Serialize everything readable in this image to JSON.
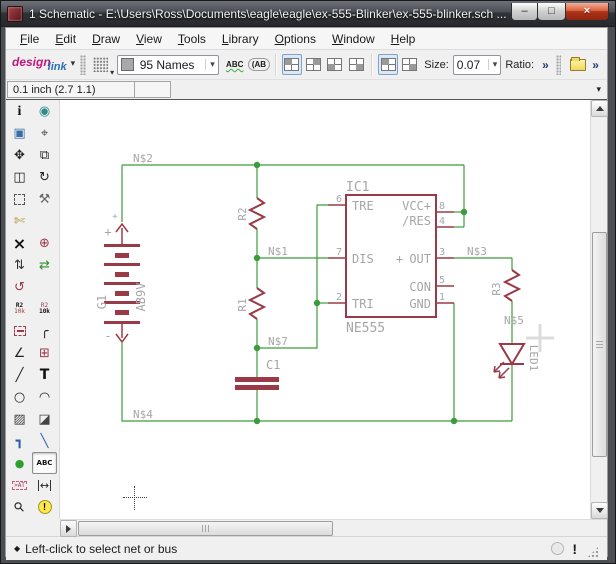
{
  "window": {
    "title": "1 Schematic - E:\\Users\\Ross\\Documents\\eagle\\eagle\\ex-555-Blinker\\ex-555-blinker.sch ...",
    "minimize": "–",
    "maximize": "□",
    "close": "×"
  },
  "menu": {
    "items": [
      {
        "accel": "F",
        "rest": "ile"
      },
      {
        "accel": "E",
        "rest": "dit"
      },
      {
        "accel": "D",
        "rest": "raw"
      },
      {
        "accel": "V",
        "rest": "iew"
      },
      {
        "accel": "T",
        "rest": "ools"
      },
      {
        "accel": "L",
        "rest": "ibrary"
      },
      {
        "accel": "O",
        "rest": "ptions"
      },
      {
        "accel": "W",
        "rest": "indow"
      },
      {
        "accel": "H",
        "rest": "elp"
      }
    ]
  },
  "toolbar": {
    "logo_design": "design",
    "logo_link": "link",
    "logo_drop": "▾",
    "layer_combo_value": "95 Names",
    "combo_arrow": "▾",
    "abc": "ABC",
    "ab": "(AB",
    "size_label": "Size:",
    "size_value": "0.07",
    "ratio_label": "Ratio:",
    "chevron": "»"
  },
  "coordbar": {
    "readout": "0.1 inch (2.7 1.1)",
    "overflow_arrow": "▾"
  },
  "palette": {
    "glyphs": {
      "info": "i",
      "show": "◉",
      "display": "▣",
      "mark": "⌖",
      "move": "✥",
      "copy": "⧉",
      "mirror": "◫",
      "rotate": "↻",
      "change": "⚒",
      "cut": "✄",
      "delete": "×",
      "add": "⊕",
      "pinswap": "⇅",
      "replace": "⇄",
      "gateswap": "↺",
      "name_top": "R2",
      "name_bottom": "10k",
      "miter": "╭",
      "split": "∠",
      "invoke": "⊞",
      "wire": "╱",
      "text": "T",
      "circle": "○",
      "arc": "◠",
      "rect": "▨",
      "polygon": "◪",
      "bus": "┓",
      "net": "╲",
      "junction": "●",
      "label": "ABC",
      "attribute": ">AT",
      "dimension": "↔",
      "erc": "⚲",
      "errors": "!"
    }
  },
  "schematic": {
    "colors": {
      "net": "#3c9c3c",
      "symbol": "#9b3a47",
      "label": "#a6a6a6",
      "accent_red": "#cc2a2a"
    },
    "nets": {
      "n1": "N$1",
      "n2": "N$2",
      "n3": "N$3",
      "n4": "N$4",
      "n5": "N$5",
      "n7": "N$7"
    },
    "battery": {
      "name": "G1",
      "value": "AB9V",
      "plus_small": "+",
      "plus": "+",
      "minus": "-"
    },
    "r1": "R1",
    "r2": "R2",
    "r3": "R3",
    "c1": "C1",
    "led": "LED1",
    "ic": {
      "name": "IC1",
      "value": "NE555",
      "out_prefix": "+",
      "pins_left": [
        {
          "num": "6",
          "name": "TRE"
        },
        {
          "num": "7",
          "name": "DIS"
        },
        {
          "num": "2",
          "name": "TRI"
        }
      ],
      "pins_right": [
        {
          "num": "8",
          "name": "VCC+"
        },
        {
          "num": "4",
          "name": "/RES"
        },
        {
          "num": "3",
          "name": "OUT"
        },
        {
          "num": "5",
          "name": "CON"
        },
        {
          "num": "1",
          "name": "GND"
        }
      ]
    }
  },
  "statusbar": {
    "bullet": "◆",
    "message": "Left-click to select net or bus",
    "alert": "!"
  }
}
